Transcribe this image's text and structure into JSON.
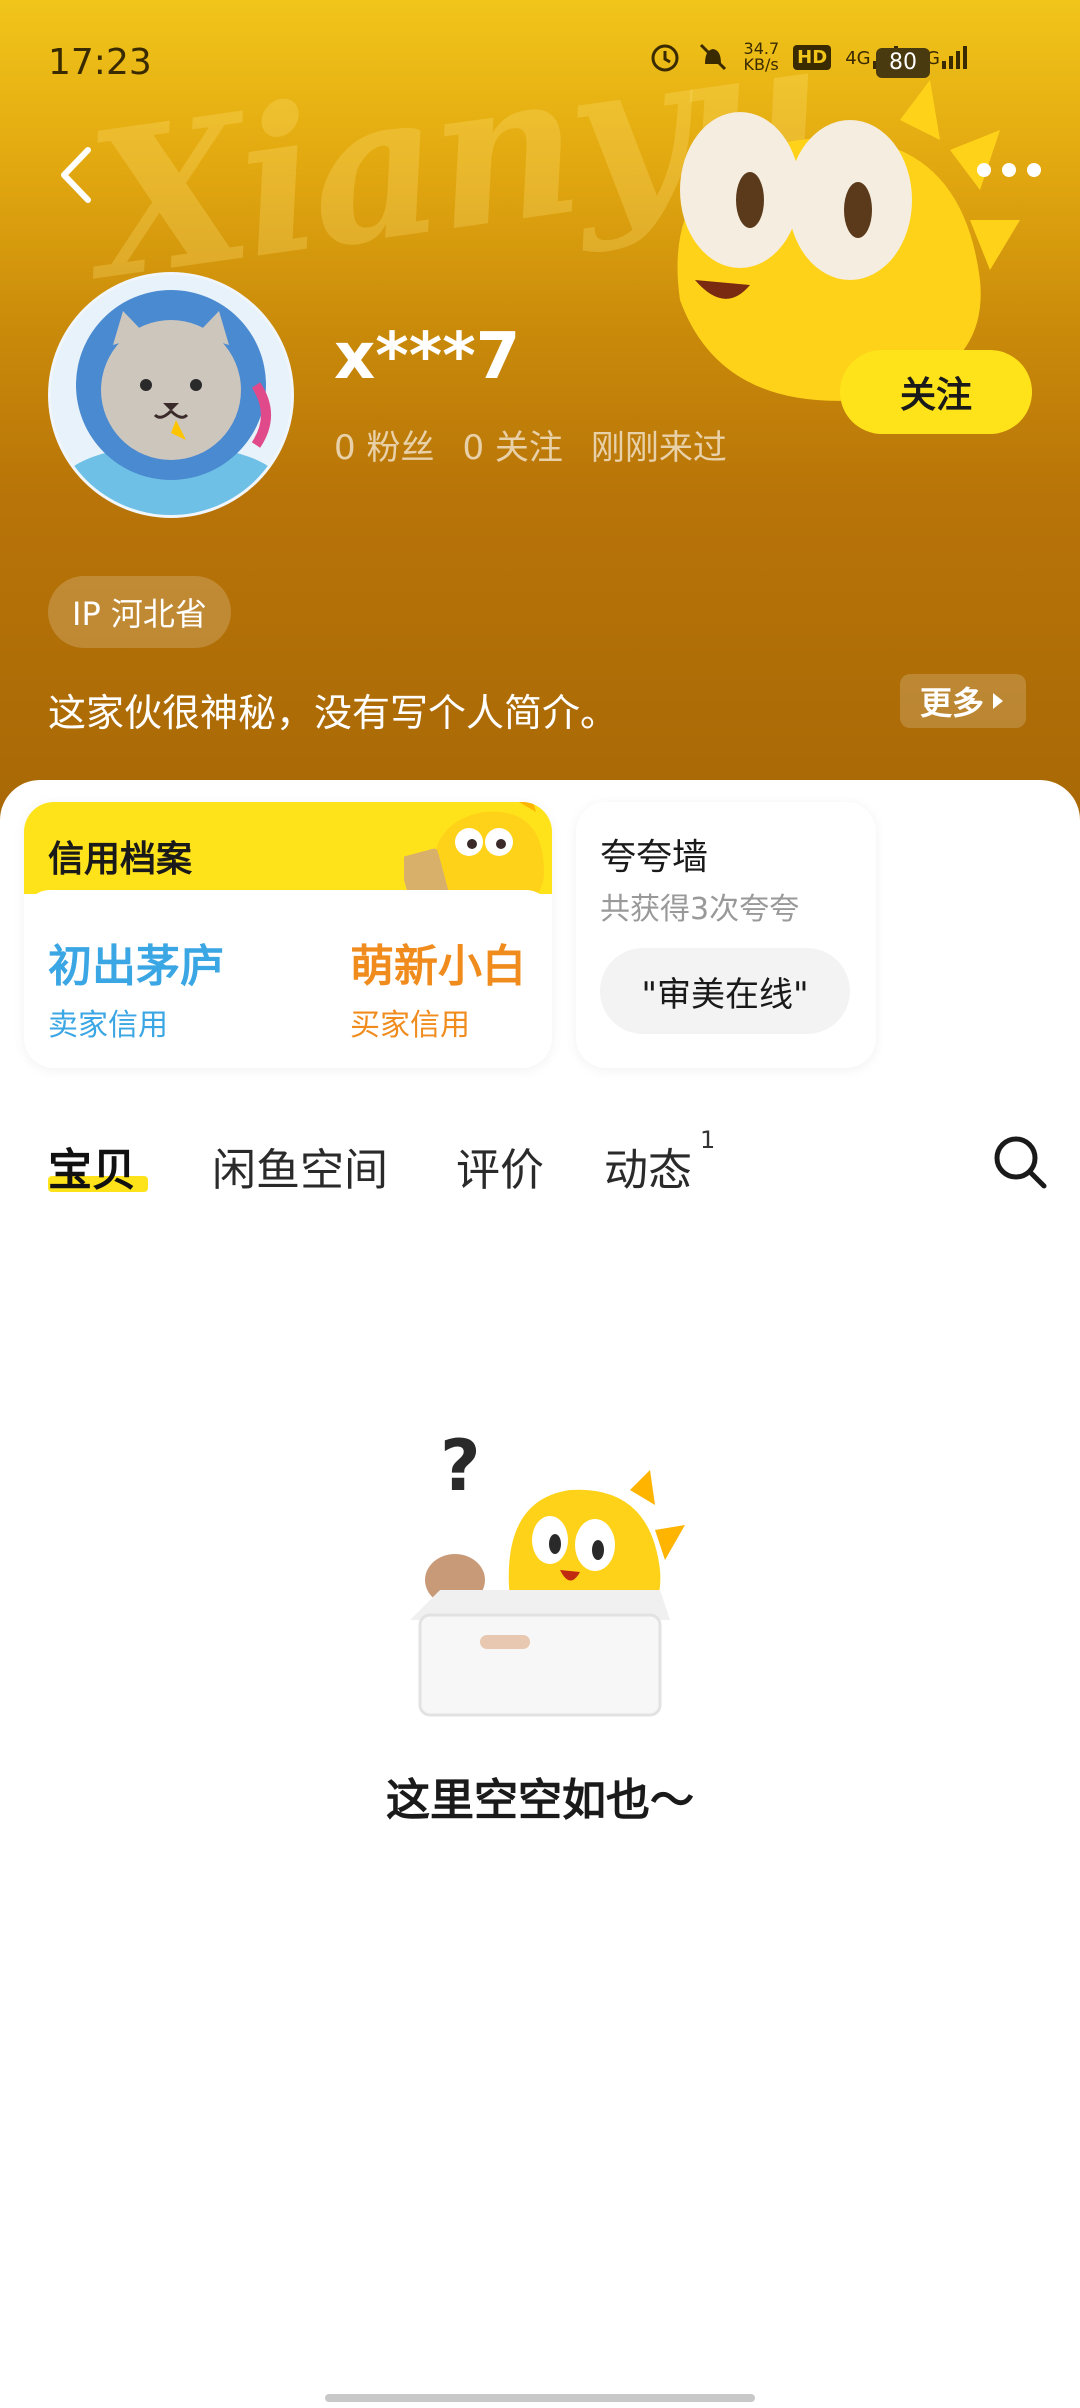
{
  "status_bar": {
    "time": "17:23",
    "net_speed": "34.7",
    "net_speed_unit": "KB/s",
    "hd": "HD",
    "net_4g": "4G",
    "net_5g": "5G",
    "battery": "80"
  },
  "profile": {
    "username": "x***7",
    "fans": "0 粉丝",
    "following": "0 关注",
    "last_seen": "刚刚来过",
    "follow_label": "关注",
    "ip_label": "IP 河北省",
    "bio": "这家伙很神秘，没有写个人简介。",
    "more_label": "更多"
  },
  "credit": {
    "title": "信用档案",
    "seller_value": "初出茅庐",
    "seller_label": "卖家信用",
    "buyer_value": "萌新小白",
    "buyer_label": "买家信用"
  },
  "praise": {
    "title": "夸夸墙",
    "subtitle": "共获得3次夸夸",
    "chip": "\"审美在线\""
  },
  "tabs": [
    {
      "label": "宝贝"
    },
    {
      "label": "闲鱼空间"
    },
    {
      "label": "评价"
    },
    {
      "label": "动态",
      "badge": "1"
    }
  ],
  "empty": {
    "text": "这里空空如也～"
  },
  "colors": {
    "accent": "#ffe31a",
    "seller": "#3ba6e4",
    "buyer": "#f08c1e"
  }
}
